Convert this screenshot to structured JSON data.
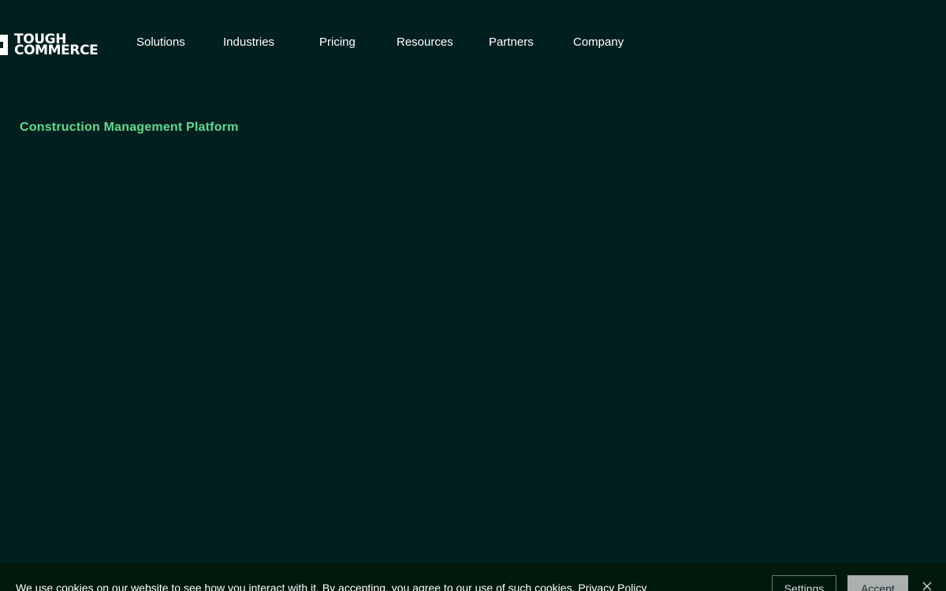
{
  "brand": {
    "logo_line1": "TOUGH",
    "logo_line2": "COMMERCE"
  },
  "nav": {
    "items": [
      {
        "label": "Solutions"
      },
      {
        "label": "Industries"
      },
      {
        "label": "Pricing"
      },
      {
        "label": "Resources"
      },
      {
        "label": "Partners"
      },
      {
        "label": "Company"
      }
    ]
  },
  "hero": {
    "eyebrow": "Construction Management Platform"
  },
  "cookie_banner": {
    "message": "We use cookies on our website to see how you interact with it. By accepting, you agree to our use of such cookies.",
    "privacy_link": "Privacy Policy",
    "settings_label": "Settings",
    "accept_label": "Accept",
    "close_icon": "close-icon"
  },
  "colors": {
    "background": "#001f1f",
    "accent": "#5edb8f",
    "cookie_bar": "#00190d",
    "accept_button": "#a9b0af"
  }
}
